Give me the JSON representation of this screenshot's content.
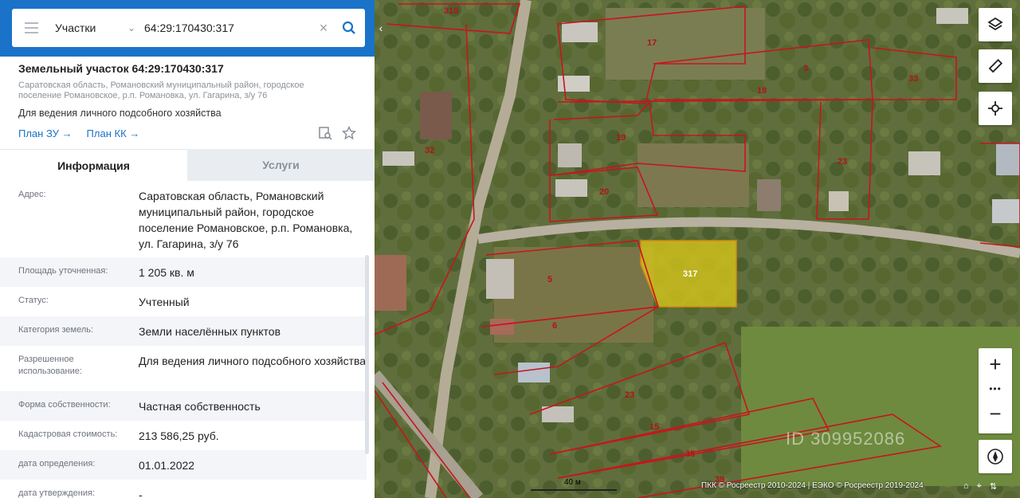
{
  "search": {
    "type_label": "Участки",
    "query": "64:29:170430:317"
  },
  "parcel": {
    "title": "Земельный участок 64:29:170430:317",
    "address": "Саратовская область, Романовский муниципальный район, городское поселение Романовское, р.п. Романовка, ул. Гагарина, з/у 76",
    "use": "Для ведения личного подсобного хозяйства",
    "plan_zu": "План ЗУ",
    "plan_kk": "План КК"
  },
  "tabs": {
    "info": "Информация",
    "services": "Услуги"
  },
  "info_rows": [
    {
      "key": "Адрес:",
      "value": "Саратовская область, Романовский муниципальный район, городское поселение Романовское, р.п. Романовка, ул. Гагарина, з/у 76"
    },
    {
      "key": "Площадь уточненная:",
      "value": "1 205 кв. м"
    },
    {
      "key": "Статус:",
      "value": "Учтенный"
    },
    {
      "key": "Категория земель:",
      "value": "Земли населённых пунктов"
    },
    {
      "key": "Разрешенное использование:",
      "value": "Для ведения личного подсобного хозяйства"
    },
    {
      "key": "Форма собственности:",
      "value": "Частная собственность"
    },
    {
      "key": "Кадастровая стоимость:",
      "value": "213 586,25 руб."
    },
    {
      "key": "дата определения:",
      "value": "01.01.2022"
    },
    {
      "key": "дата утверждения:",
      "value": "-"
    }
  ],
  "map": {
    "parcel_labels": [
      "310",
      "17",
      "3",
      "33",
      "18",
      "19",
      "32",
      "20",
      "23",
      "5",
      "317",
      "6",
      "23",
      "15",
      "35",
      "39"
    ],
    "highlight_color": "#d4c41a",
    "boundary_color": "#c8141e",
    "scale_label": "40 м",
    "attribution": "ПКК © Росреестр 2010-2024 | ЕЭКО © Росреестр 2019-2024",
    "watermark": "ID 309952086"
  },
  "colors": {
    "accent": "#1a73c8"
  }
}
